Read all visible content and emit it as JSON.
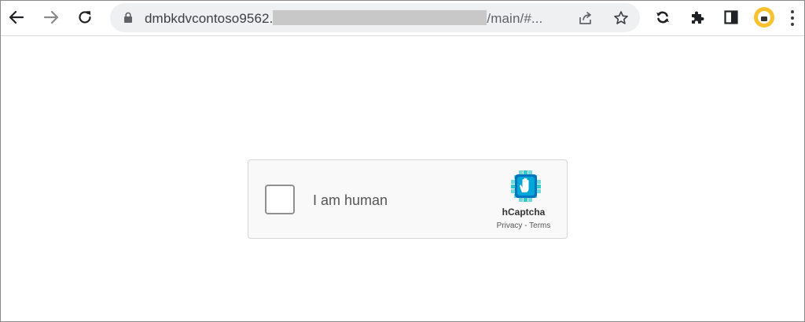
{
  "browser": {
    "nav": {
      "back_icon": "arrow-left-icon",
      "forward_icon": "arrow-right-icon",
      "reload_icon": "reload-icon"
    },
    "address_bar": {
      "lock_icon": "lock-icon",
      "url_host": "dmbkdvcontoso9562.",
      "url_path": "/main/#...",
      "share_icon": "share-icon",
      "bookmark_icon": "star-icon"
    },
    "toolbar_icons": [
      "sync-icon",
      "puzzle-extensions-icon",
      "side-panel-icon",
      "profile-avatar-icon",
      "kebab-menu-icon"
    ],
    "colors": {
      "avatar": "#fbc02d",
      "omnibox_bg": "#eef0f2"
    }
  },
  "captcha": {
    "label": "I am human",
    "brand": "hCaptcha",
    "links": {
      "privacy": "Privacy",
      "separator": " - ",
      "terms": "Terms"
    },
    "logo_icon": "hcaptcha-hand-logo",
    "colors": {
      "logo_primary": "#0074bf",
      "logo_secondary": "#00bfbf",
      "panel_bg": "#f9f9f9"
    }
  }
}
